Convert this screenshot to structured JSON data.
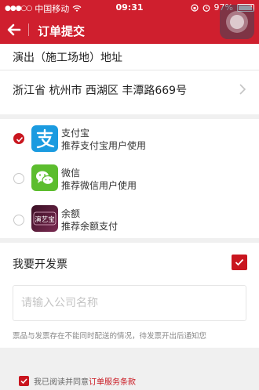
{
  "status_bar": {
    "signal_dots": "●●●○○",
    "carrier": "中国移动",
    "wifi_icon": "wifi-icon",
    "time": "09:31",
    "battery": "97%",
    "battery_level": 0.97
  },
  "nav": {
    "title": "订单提交"
  },
  "address": {
    "title": "演出（施工场地）地址",
    "value": "浙江省 杭州市 西湖区 丰潭路669号"
  },
  "payment": {
    "options": [
      {
        "name": "支付宝",
        "desc": "推荐支付宝用户使用",
        "selected": true,
        "icon": "alipay-icon",
        "color": "#1b9be0"
      },
      {
        "name": "微信",
        "desc": "推荐微信用户使用",
        "selected": false,
        "icon": "wechat-icon",
        "color": "#5cbd2e"
      },
      {
        "name": "余额",
        "desc": "推荐余额支付",
        "selected": false,
        "icon": "balance-icon",
        "color": "#5a1f3a"
      }
    ],
    "balance_logo_text": "演艺宝"
  },
  "invoice": {
    "label": "我要开发票",
    "checked": true,
    "company_placeholder": "请输入公司名称",
    "note": "票品与发票存在不能同时配送的情况，待发票开出后通知您"
  },
  "agreement": {
    "prefix": "我已阅读并同意",
    "link": "订单服务条款",
    "checked": true
  },
  "colors": {
    "brand_red": "#cf1f2e",
    "accent_red": "#c9161f"
  }
}
